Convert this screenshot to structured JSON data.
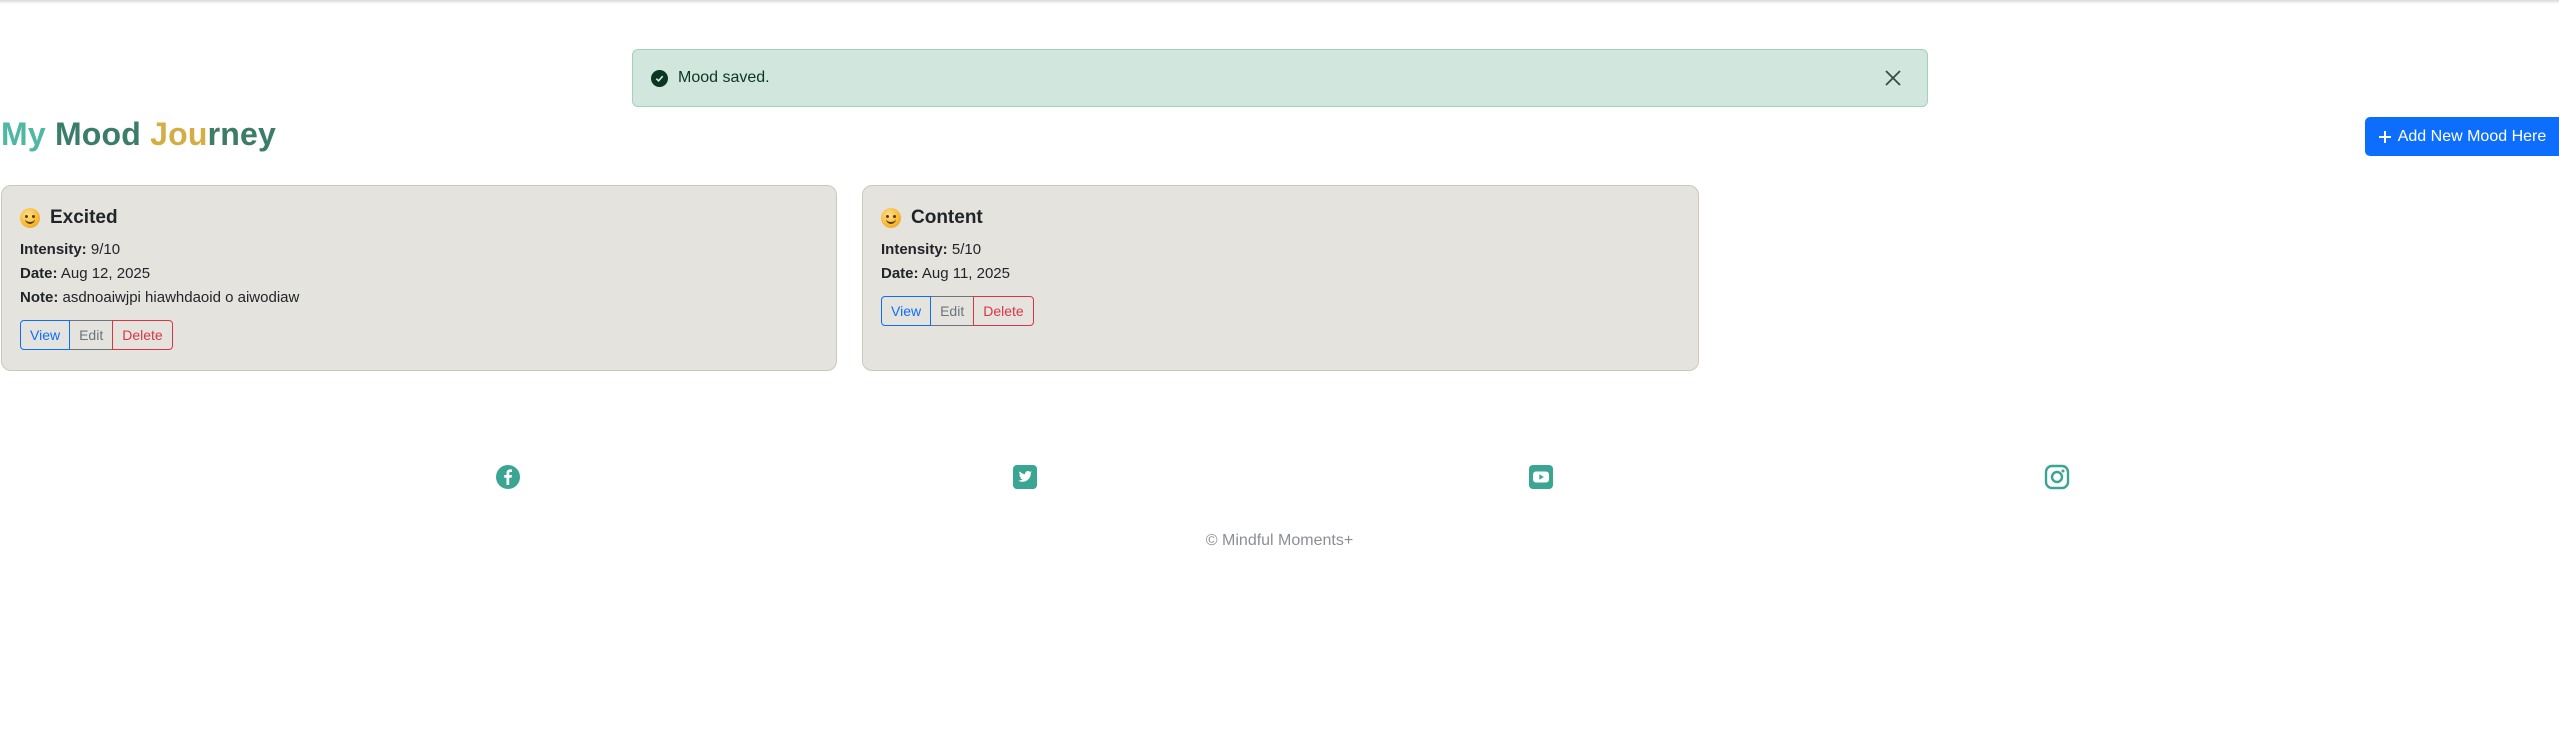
{
  "alert": {
    "message": "Mood saved.",
    "icon": "check-circle-icon",
    "close_icon": "close-icon"
  },
  "header": {
    "title_parts": [
      "My",
      "Mood",
      "Jou",
      "rney"
    ],
    "add_button_label": "Add New Mood Here",
    "add_button_icon": "plus-icon"
  },
  "moods": [
    {
      "emoji": "hugging-face-emoji",
      "name": "Excited",
      "intensity_label": "Intensity:",
      "intensity": "9/10",
      "date_label": "Date:",
      "date": "Aug 12, 2025",
      "note_label": "Note:",
      "note": "asdnoaiwjpi hiawhdaoid o aiwodiaw",
      "actions": [
        "View",
        "Edit",
        "Delete"
      ]
    },
    {
      "emoji": "smiling-face-emoji",
      "name": "Content",
      "intensity_label": "Intensity:",
      "intensity": "5/10",
      "date_label": "Date:",
      "date": "Aug 11, 2025",
      "actions": [
        "View",
        "Edit",
        "Delete"
      ]
    }
  ],
  "social": [
    "facebook-icon",
    "twitter-icon",
    "youtube-icon",
    "instagram-icon"
  ],
  "footer": {
    "text": "© Mindful Moments+"
  },
  "colors": {
    "accent": "#4fb7a3",
    "primary": "#0d6efd",
    "card_bg": "#e5e3de",
    "alert_bg": "#d1e7dd"
  }
}
